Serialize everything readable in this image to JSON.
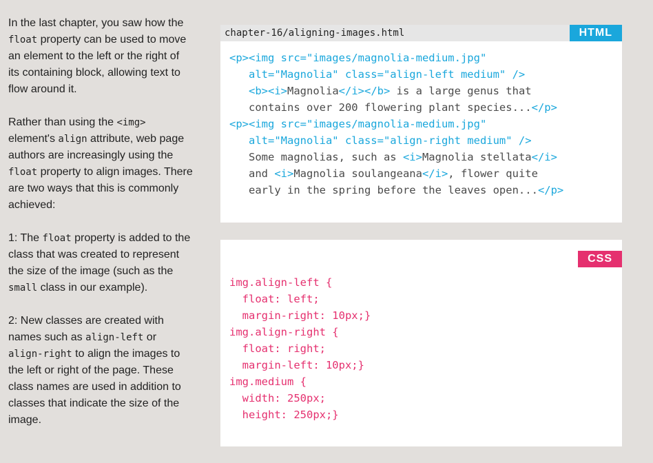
{
  "prose": {
    "para1": [
      {
        "t": "In the last chapter, you saw how the "
      },
      {
        "t": "float",
        "code": true
      },
      {
        "t": " property can be used to move an element to the left or the right of its containing block, allowing text to flow around it."
      }
    ],
    "para2": [
      {
        "t": "Rather than using the "
      },
      {
        "t": "<img>",
        "code": true
      },
      {
        "t": " element's "
      },
      {
        "t": "align",
        "code": true
      },
      {
        "t": " attribute, web page authors are increasingly using the "
      },
      {
        "t": "float",
        "code": true
      },
      {
        "t": " property to align images. There are two ways that this is commonly achieved:"
      }
    ],
    "para3": [
      {
        "t": "1: The "
      },
      {
        "t": "float",
        "code": true
      },
      {
        "t": " property is added to the class that was created to represent the size of the image (such as the "
      },
      {
        "t": "small",
        "code": true
      },
      {
        "t": " class in our example)."
      }
    ],
    "para4": [
      {
        "t": "2: New classes are created with names such as "
      },
      {
        "t": "align-left",
        "code": true
      },
      {
        "t": " or "
      },
      {
        "t": "align-right",
        "code": true
      },
      {
        "t": " to align the images to the left or right of the page. These class names are used in addition to classes that indicate the size of the image."
      }
    ]
  },
  "html_panel": {
    "filename": "chapter-16/aligning-images.html",
    "badge": "HTML",
    "lines": [
      [
        {
          "c": "tag",
          "t": "<p><img src=\"images/magnolia-medium.jpg\""
        }
      ],
      [
        {
          "c": "tag",
          "t": "   alt=\"Magnolia\" class=\"align-left medium\" />"
        }
      ],
      [
        {
          "c": "tag",
          "t": "   <b><i>"
        },
        {
          "c": "txt",
          "t": "Magnolia"
        },
        {
          "c": "tag",
          "t": "</i></b>"
        },
        {
          "c": "txt",
          "t": " is a large genus that"
        }
      ],
      [
        {
          "c": "txt",
          "t": "   contains over 200 flowering plant species..."
        },
        {
          "c": "tag",
          "t": "</p>"
        }
      ],
      [
        {
          "c": "tag",
          "t": "<p><img src=\"images/magnolia-medium.jpg\""
        }
      ],
      [
        {
          "c": "tag",
          "t": "   alt=\"Magnolia\" class=\"align-right medium\" />"
        }
      ],
      [
        {
          "c": "txt",
          "t": "   Some magnolias, such as "
        },
        {
          "c": "tag",
          "t": "<i>"
        },
        {
          "c": "txt",
          "t": "Magnolia stellata"
        },
        {
          "c": "tag",
          "t": "</i>"
        }
      ],
      [
        {
          "c": "txt",
          "t": "   and "
        },
        {
          "c": "tag",
          "t": "<i>"
        },
        {
          "c": "txt",
          "t": "Magnolia soulangeana"
        },
        {
          "c": "tag",
          "t": "</i>"
        },
        {
          "c": "txt",
          "t": ", flower quite"
        }
      ],
      [
        {
          "c": "txt",
          "t": "   early in the spring before the leaves open..."
        },
        {
          "c": "tag",
          "t": "</p>"
        }
      ]
    ]
  },
  "css_panel": {
    "badge": "CSS",
    "lines": [
      "img.align-left {",
      "  float: left;",
      "  margin-right: 10px;}",
      "img.align-right {",
      "  float: right;",
      "  margin-left: 10px;}",
      "img.medium {",
      "  width: 250px;",
      "  height: 250px;}"
    ]
  },
  "colors": {
    "html_accent": "#1aa7dc",
    "css_accent": "#e5306f",
    "page_background": "#e2dfdc",
    "panel_background": "#ffffff",
    "code_text": "#4a4a4a"
  }
}
